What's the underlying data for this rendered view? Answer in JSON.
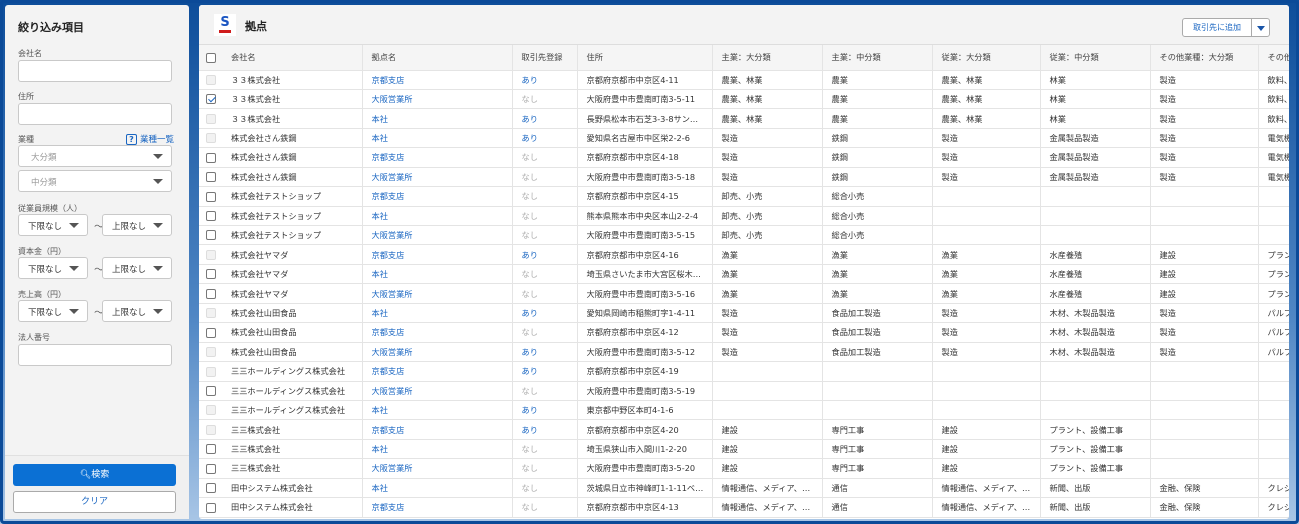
{
  "sidebar": {
    "title": "絞り込み項目",
    "company_label": "会社名",
    "address_label": "住所",
    "industry_label": "業種",
    "industry_list_link": "業種一覧",
    "industry_major_placeholder": "大分類",
    "industry_middle_placeholder": "中分類",
    "employees_label": "従業員規模（人）",
    "capital_label": "資本金（円）",
    "sales_label": "売上高（円）",
    "min_label": "下限なし",
    "max_label": "上限なし",
    "tilde": "〜",
    "corp_number_label": "法人番号",
    "search_button": "検索",
    "clear_button": "クリア"
  },
  "header": {
    "logo_letter": "S",
    "title": "拠点",
    "add_button": "取引先に追加"
  },
  "table": {
    "columns": [
      "会社名",
      "拠点名",
      "取引先登録",
      "住所",
      "主業：大分類",
      "主業：中分類",
      "従業：大分類",
      "従業：中分類",
      "その他業種：大分類",
      "その他"
    ],
    "rows": [
      {
        "state": "disabled",
        "c": [
          "３３株式会社",
          "京都支店",
          "あり",
          "京都府京都市中京区4-11",
          "農業、林業",
          "農業",
          "農業、林業",
          "林業",
          "製造",
          "飲料、"
        ]
      },
      {
        "state": "checked",
        "c": [
          "３３株式会社",
          "大阪営業所",
          "なし",
          "大阪府豊中市豊南町南3-5-11",
          "農業、林業",
          "農業",
          "農業、林業",
          "林業",
          "製造",
          "飲料、"
        ]
      },
      {
        "state": "disabled",
        "c": [
          "３３株式会社",
          "本社",
          "あり",
          "長野県松本市石芝3-3-8サン…",
          "農業、林業",
          "農業",
          "農業、林業",
          "林業",
          "製造",
          "飲料、"
        ]
      },
      {
        "state": "disabled",
        "c": [
          "株式会社さん鉄鋼",
          "本社",
          "あり",
          "愛知県名古屋市中区栄2-2-6",
          "製造",
          "鉄鋼",
          "製造",
          "金属製品製造",
          "製造",
          "電気機"
        ]
      },
      {
        "state": "empty",
        "c": [
          "株式会社さん鉄鋼",
          "京都支店",
          "なし",
          "京都府京都市中京区4-18",
          "製造",
          "鉄鋼",
          "製造",
          "金属製品製造",
          "製造",
          "電気機"
        ]
      },
      {
        "state": "empty",
        "c": [
          "株式会社さん鉄鋼",
          "大阪営業所",
          "なし",
          "大阪府豊中市豊南町南3-5-18",
          "製造",
          "鉄鋼",
          "製造",
          "金属製品製造",
          "製造",
          "電気機"
        ]
      },
      {
        "state": "empty",
        "c": [
          "株式会社テストショップ",
          "京都支店",
          "なし",
          "京都府京都市中京区4-15",
          "卸売、小売",
          "総合小売",
          "",
          "",
          "",
          ""
        ]
      },
      {
        "state": "empty",
        "c": [
          "株式会社テストショップ",
          "本社",
          "なし",
          "熊本県熊本市中央区本山2-2-4",
          "卸売、小売",
          "総合小売",
          "",
          "",
          "",
          ""
        ]
      },
      {
        "state": "empty",
        "c": [
          "株式会社テストショップ",
          "大阪営業所",
          "なし",
          "大阪府豊中市豊南町南3-5-15",
          "卸売、小売",
          "総合小売",
          "",
          "",
          "",
          ""
        ]
      },
      {
        "state": "disabled",
        "c": [
          "株式会社ヤマダ",
          "京都支店",
          "あり",
          "京都府京都市中京区4-16",
          "漁業",
          "漁業",
          "漁業",
          "水産養殖",
          "建設",
          "プラン"
        ]
      },
      {
        "state": "empty",
        "c": [
          "株式会社ヤマダ",
          "本社",
          "なし",
          "埼玉県さいたま市大宮区桜木…",
          "漁業",
          "漁業",
          "漁業",
          "水産養殖",
          "建設",
          "プラン"
        ]
      },
      {
        "state": "empty",
        "c": [
          "株式会社ヤマダ",
          "大阪営業所",
          "なし",
          "大阪府豊中市豊南町南3-5-16",
          "漁業",
          "漁業",
          "漁業",
          "水産養殖",
          "建設",
          "プラン"
        ]
      },
      {
        "state": "disabled",
        "c": [
          "株式会社山田食品",
          "本社",
          "あり",
          "愛知県岡崎市稲熊町字1-4-11",
          "製造",
          "食品加工製造",
          "製造",
          "木材、木製品製造",
          "製造",
          "パルプ"
        ]
      },
      {
        "state": "empty",
        "c": [
          "株式会社山田食品",
          "京都支店",
          "なし",
          "京都府京都市中京区4-12",
          "製造",
          "食品加工製造",
          "製造",
          "木材、木製品製造",
          "製造",
          "パルプ"
        ]
      },
      {
        "state": "disabled",
        "c": [
          "株式会社山田食品",
          "大阪営業所",
          "あり",
          "大阪府豊中市豊南町南3-5-12",
          "製造",
          "食品加工製造",
          "製造",
          "木材、木製品製造",
          "製造",
          "パルプ"
        ]
      },
      {
        "state": "disabled",
        "c": [
          "三三ホールディングス株式会社",
          "京都支店",
          "あり",
          "京都府京都市中京区4-19",
          "",
          "",
          "",
          "",
          "",
          ""
        ]
      },
      {
        "state": "empty",
        "c": [
          "三三ホールディングス株式会社",
          "大阪営業所",
          "なし",
          "大阪府豊中市豊南町南3-5-19",
          "",
          "",
          "",
          "",
          "",
          ""
        ]
      },
      {
        "state": "disabled",
        "c": [
          "三三ホールディングス株式会社",
          "本社",
          "あり",
          "東京都中野区本町4-1-6",
          "",
          "",
          "",
          "",
          "",
          ""
        ]
      },
      {
        "state": "disabled",
        "c": [
          "三三株式会社",
          "京都支店",
          "あり",
          "京都府京都市中京区4-20",
          "建設",
          "専門工事",
          "建設",
          "プラント、設備工事",
          "",
          ""
        ]
      },
      {
        "state": "empty",
        "c": [
          "三三株式会社",
          "本社",
          "なし",
          "埼玉県狭山市入間川1-2-20",
          "建設",
          "専門工事",
          "建設",
          "プラント、設備工事",
          "",
          ""
        ]
      },
      {
        "state": "empty",
        "c": [
          "三三株式会社",
          "大阪営業所",
          "なし",
          "大阪府豊中市豊南町南3-5-20",
          "建設",
          "専門工事",
          "建設",
          "プラント、設備工事",
          "",
          ""
        ]
      },
      {
        "state": "empty",
        "c": [
          "田中システム株式会社",
          "本社",
          "なし",
          "茨城県日立市神峰町1-1-11ベ…",
          "情報通信、メディア、…",
          "通信",
          "情報通信、メディア、…",
          "新聞、出版",
          "金融、保険",
          "クレジ"
        ]
      },
      {
        "state": "empty",
        "c": [
          "田中システム株式会社",
          "京都支店",
          "なし",
          "京都府京都市中京区4-13",
          "情報通信、メディア、…",
          "通信",
          "情報通信、メディア、…",
          "新聞、出版",
          "金融、保険",
          "クレジ"
        ]
      }
    ]
  }
}
